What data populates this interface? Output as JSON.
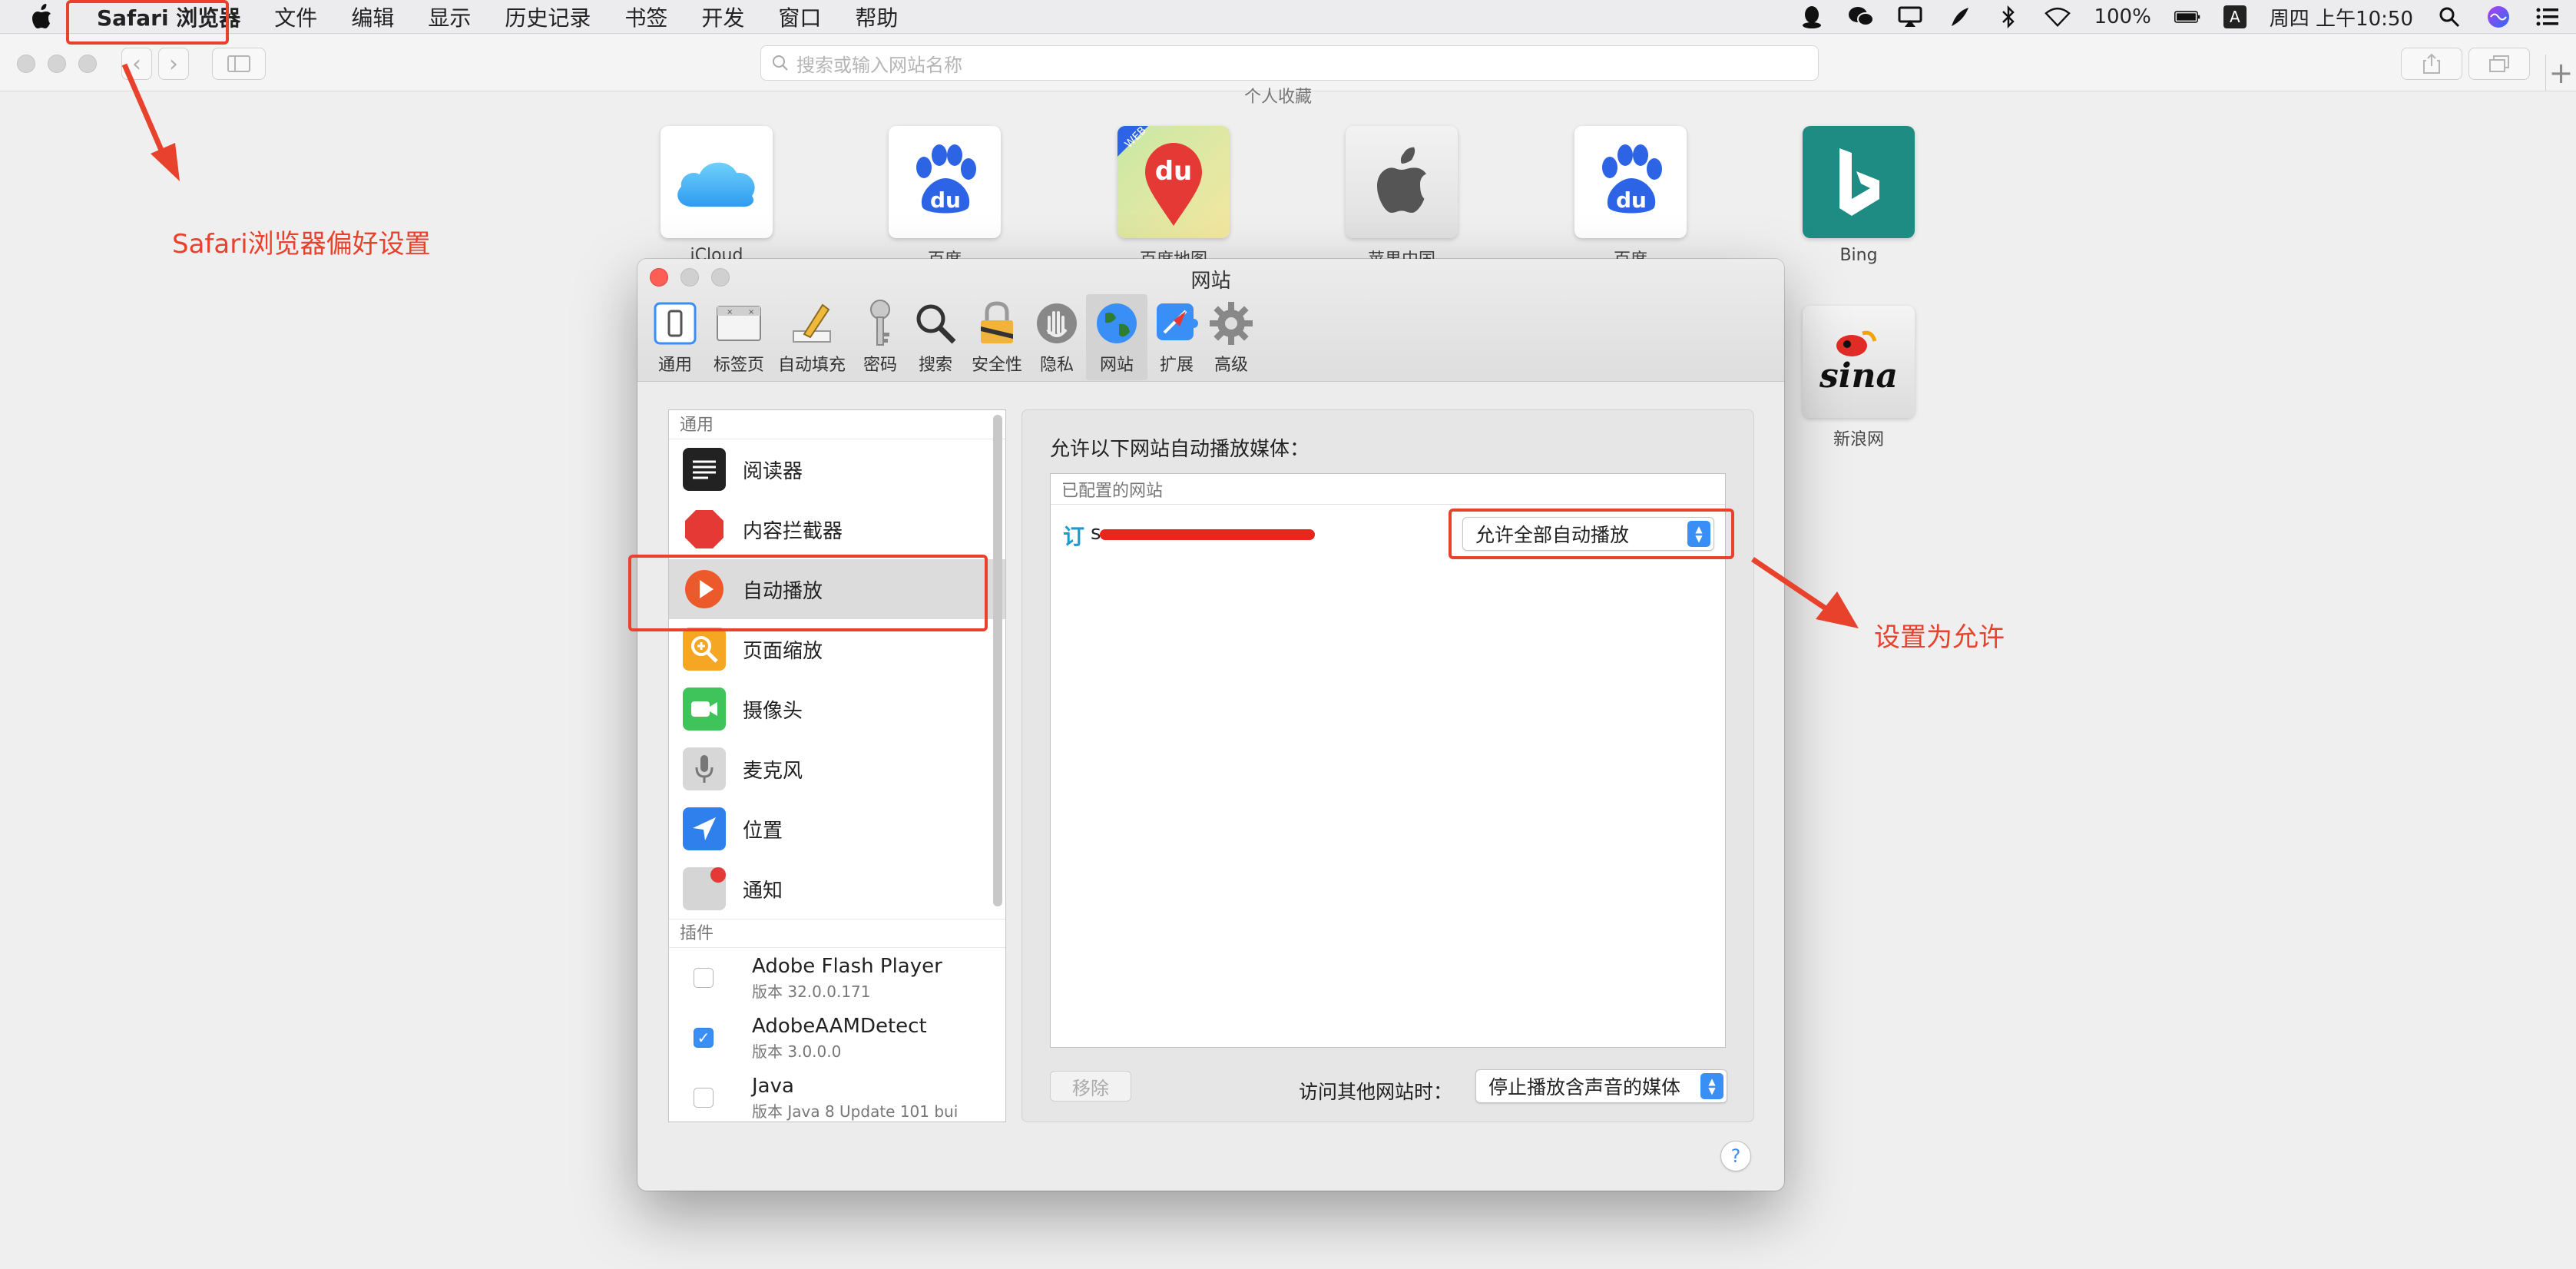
{
  "menubar": {
    "app_name": "Safari 浏览器",
    "items": [
      "文件",
      "编辑",
      "显示",
      "历史记录",
      "书签",
      "开发",
      "窗口",
      "帮助"
    ],
    "battery": "100%",
    "input_source": "A",
    "clock": "周四 上午10:50"
  },
  "toolbar": {
    "address_placeholder": "搜索或输入网站名称"
  },
  "favorites": {
    "heading": "个人收藏",
    "tiles": [
      {
        "label": "iCloud",
        "icon": "icloud-icon"
      },
      {
        "label": "百度",
        "icon": "baidu-icon"
      },
      {
        "label": "百度地图",
        "icon": "baidu-map-icon"
      },
      {
        "label": "苹果中国",
        "icon": "apple-icon"
      },
      {
        "label": "百度",
        "icon": "baidu-icon"
      },
      {
        "label": "Bing",
        "icon": "bing-icon"
      },
      {
        "label": "新浪网",
        "icon": "sina-icon"
      }
    ]
  },
  "prefs": {
    "title": "网站",
    "tabs": [
      "通用",
      "标签页",
      "自动填充",
      "密码",
      "搜索",
      "安全性",
      "隐私",
      "网站",
      "扩展",
      "高级"
    ],
    "selected_tab": "网站",
    "sidebar": {
      "general_header": "通用",
      "items": [
        "阅读器",
        "内容拦截器",
        "自动播放",
        "页面缩放",
        "摄像头",
        "麦克风",
        "位置",
        "通知"
      ],
      "selected": "自动播放",
      "plugins_header": "插件",
      "plugins": [
        {
          "name": "Adobe Flash Player",
          "version": "版本 32.0.0.171",
          "checked": false
        },
        {
          "name": "AdobeAAMDetect",
          "version": "版本 3.0.0.0",
          "checked": true
        },
        {
          "name": "Java",
          "version": "版本 Java 8 Update 101 bui",
          "checked": false
        }
      ]
    },
    "content": {
      "label": "允许以下网站自动播放媒体：",
      "configured_header": "已配置的网站",
      "site_icon": "订",
      "site_name": "s",
      "site_setting": "允许全部自动播放",
      "remove_label": "移除",
      "other_label": "访问其他网站时：",
      "other_setting": "停止播放含声音的媒体"
    },
    "help_label": "?"
  },
  "annotations": {
    "prefs_note": "Safari浏览器偏好设置",
    "allow_note": "设置为允许"
  },
  "colors": {
    "annotation": "#e8412c",
    "accent": "#3a8ff7"
  }
}
